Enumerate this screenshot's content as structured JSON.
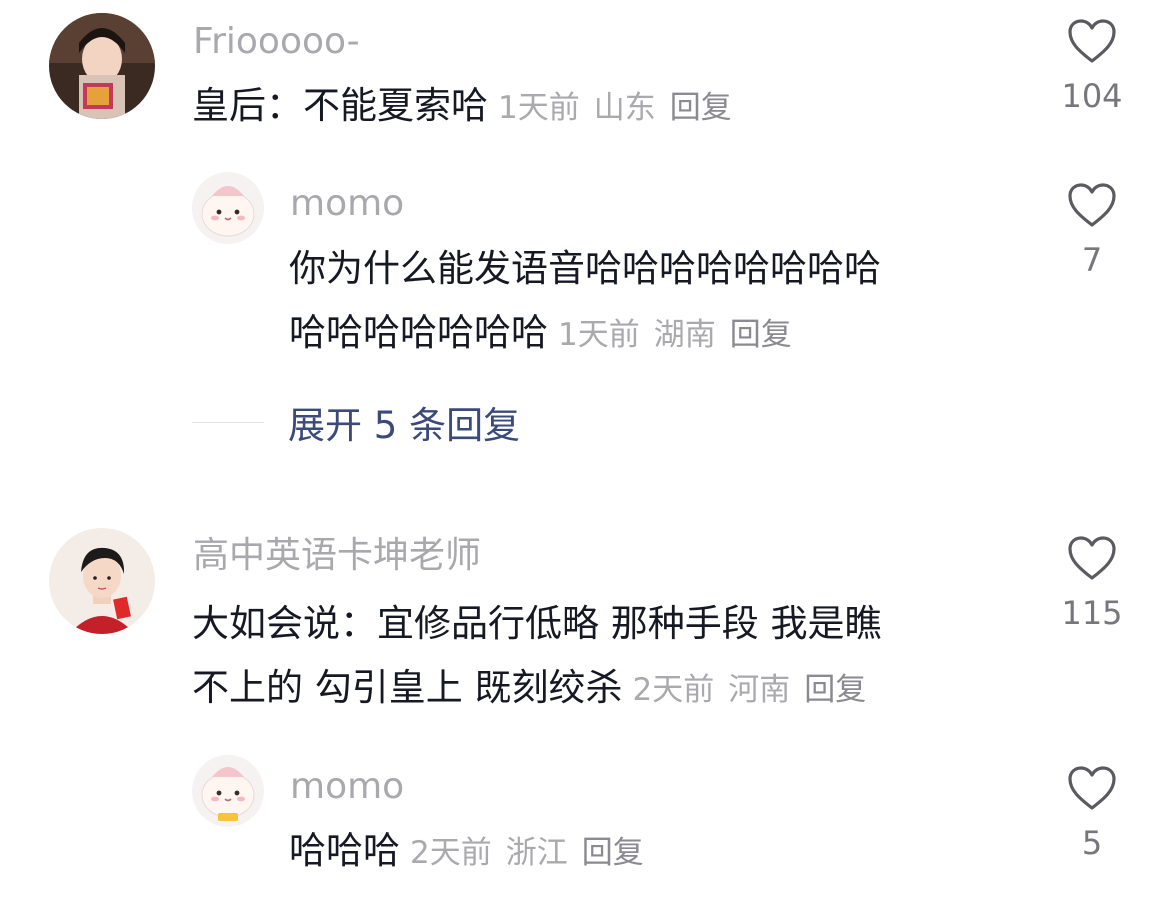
{
  "comments": [
    {
      "username": "Friooooo-",
      "text_lines": [
        "皇后：不能夏索哈"
      ],
      "time": "1天前",
      "location": "山东",
      "reply_label": "回复",
      "likes": "104",
      "replies": [
        {
          "username": "momo",
          "text_lines": [
            "你为什么能发语音哈哈哈哈哈哈哈哈",
            "哈哈哈哈哈哈哈"
          ],
          "time": "1天前",
          "location": "湖南",
          "reply_label": "回复",
          "likes": "7"
        }
      ],
      "expand_label": "展开 5 条回复"
    },
    {
      "username": "高中英语卡坤老师",
      "text_lines": [
        "大如会说：宜修品行低略 那种手段 我是瞧",
        "不上的 勾引皇上 既刻绞杀"
      ],
      "time": "2天前",
      "location": "河南",
      "reply_label": "回复",
      "likes": "115",
      "replies": [
        {
          "username": "momo",
          "text_lines": [
            "哈哈哈"
          ],
          "time": "2天前",
          "location": "浙江",
          "reply_label": "回复",
          "likes": "5"
        }
      ]
    }
  ],
  "icons": {
    "like": "heart-outline-icon"
  },
  "colors": {
    "username": "#a8a8ad",
    "text": "#161823",
    "meta": "#a9a9ae",
    "expand": "#3a4a7a",
    "like_count": "#76767c"
  }
}
